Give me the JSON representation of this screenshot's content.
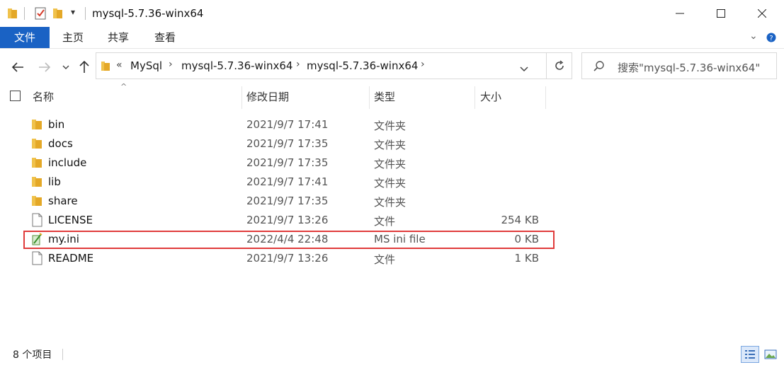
{
  "window": {
    "title": "mysql-5.7.36-winx64"
  },
  "ribbon": {
    "tabs": [
      {
        "label": "文件"
      },
      {
        "label": "主页"
      },
      {
        "label": "共享"
      },
      {
        "label": "查看"
      }
    ]
  },
  "address": {
    "overflow": "«",
    "crumbs": [
      "MySql",
      "mysql-5.7.36-winx64",
      "mysql-5.7.36-winx64"
    ]
  },
  "search": {
    "placeholder": "搜索\"mysql-5.7.36-winx64\""
  },
  "columns": {
    "name": "名称",
    "date": "修改日期",
    "type": "类型",
    "size": "大小"
  },
  "files": [
    {
      "name": "bin",
      "date": "2021/9/7 17:41",
      "type": "文件夹",
      "size": "",
      "icon": "folder-icon"
    },
    {
      "name": "docs",
      "date": "2021/9/7 17:35",
      "type": "文件夹",
      "size": "",
      "icon": "folder-icon"
    },
    {
      "name": "include",
      "date": "2021/9/7 17:35",
      "type": "文件夹",
      "size": "",
      "icon": "folder-icon"
    },
    {
      "name": "lib",
      "date": "2021/9/7 17:41",
      "type": "文件夹",
      "size": "",
      "icon": "folder-icon"
    },
    {
      "name": "share",
      "date": "2021/9/7 17:35",
      "type": "文件夹",
      "size": "",
      "icon": "folder-icon"
    },
    {
      "name": "LICENSE",
      "date": "2021/9/7 13:26",
      "type": "文件",
      "size": "254 KB",
      "icon": "file-icon"
    },
    {
      "name": "my.ini",
      "date": "2022/4/4 22:48",
      "type": "MS ini file",
      "size": "0 KB",
      "icon": "ini-file-icon"
    },
    {
      "name": "README",
      "date": "2021/9/7 13:26",
      "type": "文件",
      "size": "1 KB",
      "icon": "file-icon"
    }
  ],
  "status": {
    "count": "8 个项目"
  },
  "colors": {
    "accent": "#1a62c4",
    "highlight": "#e03b3b",
    "folder": "#f0c24c"
  }
}
